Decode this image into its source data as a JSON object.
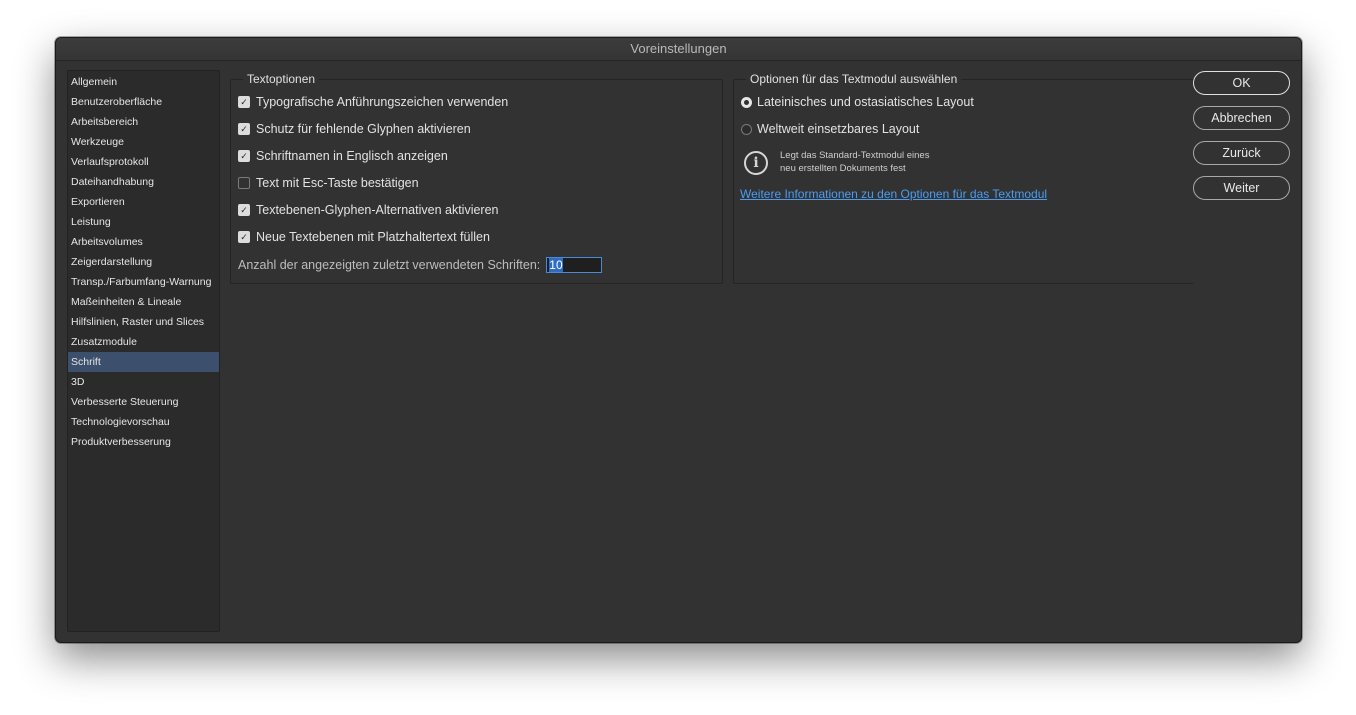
{
  "window": {
    "title": "Voreinstellungen"
  },
  "sidebar": {
    "items": [
      {
        "label": "Allgemein"
      },
      {
        "label": "Benutzeroberfläche"
      },
      {
        "label": "Arbeitsbereich"
      },
      {
        "label": "Werkzeuge"
      },
      {
        "label": "Verlaufsprotokoll"
      },
      {
        "label": "Dateihandhabung"
      },
      {
        "label": "Exportieren"
      },
      {
        "label": "Leistung"
      },
      {
        "label": "Arbeitsvolumes"
      },
      {
        "label": "Zeigerdarstellung"
      },
      {
        "label": "Transp./Farbumfang-Warnung"
      },
      {
        "label": "Maßeinheiten & Lineale"
      },
      {
        "label": "Hilfslinien, Raster und Slices"
      },
      {
        "label": "Zusatzmodule"
      },
      {
        "label": "Schrift"
      },
      {
        "label": "3D"
      },
      {
        "label": "Verbesserte Steuerung"
      },
      {
        "label": "Technologievorschau"
      },
      {
        "label": "Produktverbesserung"
      }
    ],
    "selected": "Schrift"
  },
  "text_options": {
    "title": "Textoptionen",
    "checkboxes": [
      {
        "label": "Typografische Anführungszeichen verwenden",
        "checked": true
      },
      {
        "label": "Schutz für fehlende Glyphen aktivieren",
        "checked": true
      },
      {
        "label": "Schriftnamen in Englisch anzeigen",
        "checked": true
      },
      {
        "label": "Text mit Esc-Taste bestätigen",
        "checked": false
      },
      {
        "label": "Textebenen-Glyphen-Alternativen aktivieren",
        "checked": true
      },
      {
        "label": "Neue Textebenen mit Platzhaltertext füllen",
        "checked": true
      }
    ],
    "recent_fonts_label": "Anzahl der angezeigten zuletzt verwendeten Schriften:",
    "recent_fonts_value": "10"
  },
  "text_engine": {
    "title": "Optionen für das Textmodul auswählen",
    "radios": [
      {
        "label": "Lateinisches und ostasiatisches Layout",
        "selected": true
      },
      {
        "label": "Weltweit einsetzbares Layout",
        "selected": false
      }
    ],
    "info_line1": "Legt das Standard-Textmodul eines",
    "info_line2": "neu erstellten Dokuments fest",
    "link": "Weitere Informationen zu den Optionen für das Textmodul"
  },
  "buttons": {
    "ok": "OK",
    "cancel": "Abbrechen",
    "back": "Zurück",
    "next": "Weiter"
  },
  "colors": {
    "window_bg": "#323232",
    "selection": "#3c4f6c",
    "link": "#4b9cf0"
  }
}
